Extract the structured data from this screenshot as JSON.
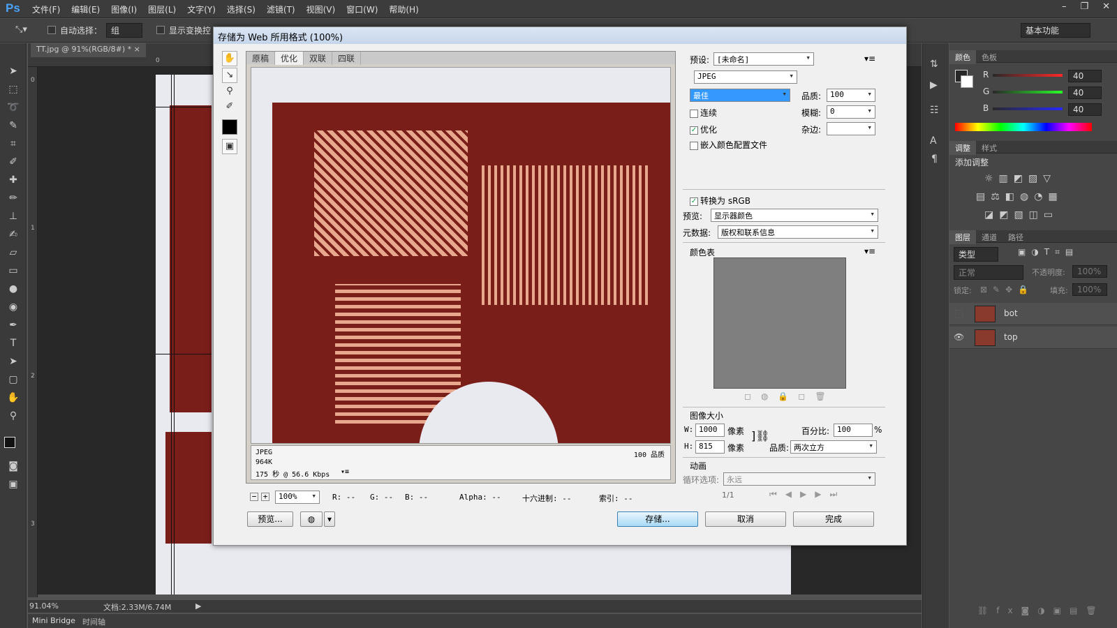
{
  "app": {
    "logo": "Ps",
    "menus": [
      "文件(F)",
      "编辑(E)",
      "图像(I)",
      "图层(L)",
      "文字(Y)",
      "选择(S)",
      "滤镜(T)",
      "视图(V)",
      "窗口(W)",
      "帮助(H)"
    ],
    "workspace": "基本功能"
  },
  "options": {
    "auto_select_label": "自动选择：",
    "auto_select_value": "组",
    "show_transform_label": "显示变换控"
  },
  "document": {
    "tab": "TT.jpg @ 91%(RGB/8#) *",
    "zoom": "91.04%",
    "doc_size": "文档:2.33M/6.74M",
    "ruler_top": [
      "0"
    ],
    "ruler_left": [
      "0",
      "1",
      "2",
      "3"
    ]
  },
  "bottom_tabs": [
    "Mini Bridge",
    "时间轴"
  ],
  "dialog": {
    "title": "存储为 Web 所用格式 (100%)",
    "preview_tabs": [
      "原稿",
      "优化",
      "双联",
      "四联"
    ],
    "info": {
      "format": "JPEG",
      "size": "964K",
      "time": "175 秒 @ 56.6 Kbps",
      "quality": "100 品质"
    },
    "zoom": "100%",
    "readouts": {
      "r": "R: --",
      "g": "G: --",
      "b": "B: --",
      "alpha": "Alpha: --",
      "hex": "十六进制: --",
      "index": "索引: --"
    },
    "buttons": {
      "preview": "预览...",
      "save": "存储...",
      "cancel": "取消",
      "done": "完成"
    },
    "settings": {
      "preset_label": "预设:",
      "preset_value": "[未命名]",
      "format_value": "JPEG",
      "quality_preset": "最佳",
      "quality_label": "品质:",
      "quality_value": "100",
      "progressive": "连续",
      "blur_label": "模糊:",
      "blur_value": "0",
      "optimized": "优化",
      "matte_label": "杂边:",
      "embed_profile": "嵌入颜色配置文件",
      "convert_srgb": "转换为 sRGB",
      "preview_label": "预览:",
      "preview_value": "显示器颜色",
      "metadata_label": "元数据:",
      "metadata_value": "版权和联系信息",
      "color_table": "颜色表",
      "image_size": "图像大小",
      "w_label": "W:",
      "w_value": "1000",
      "h_label": "H:",
      "h_value": "815",
      "px": "像素",
      "percent_label": "百分比:",
      "percent_value": "100",
      "percent_unit": "%",
      "resample_label": "品质:",
      "resample_value": "两次立方",
      "animation": "动画",
      "loop_label": "循环选项:",
      "loop_value": "永远",
      "frame": "1/1"
    }
  },
  "panels": {
    "color_tabs": [
      "颜色",
      "色板"
    ],
    "rgb": [
      {
        "label": "R",
        "value": "40"
      },
      {
        "label": "G",
        "value": "40"
      },
      {
        "label": "B",
        "value": "40"
      }
    ],
    "adjust_tabs": [
      "调整",
      "样式"
    ],
    "adjust_title": "添加调整",
    "layers_tabs": [
      "图层",
      "通道",
      "路径"
    ],
    "filter_kind": "类型",
    "blend_mode": "正常",
    "opacity_label": "不透明度:",
    "opacity_value": "100%",
    "lock_label": "锁定:",
    "fill_label": "填充:",
    "fill_value": "100%",
    "layers": [
      {
        "name": "bot",
        "visible": false
      },
      {
        "name": "top",
        "visible": true
      }
    ]
  }
}
